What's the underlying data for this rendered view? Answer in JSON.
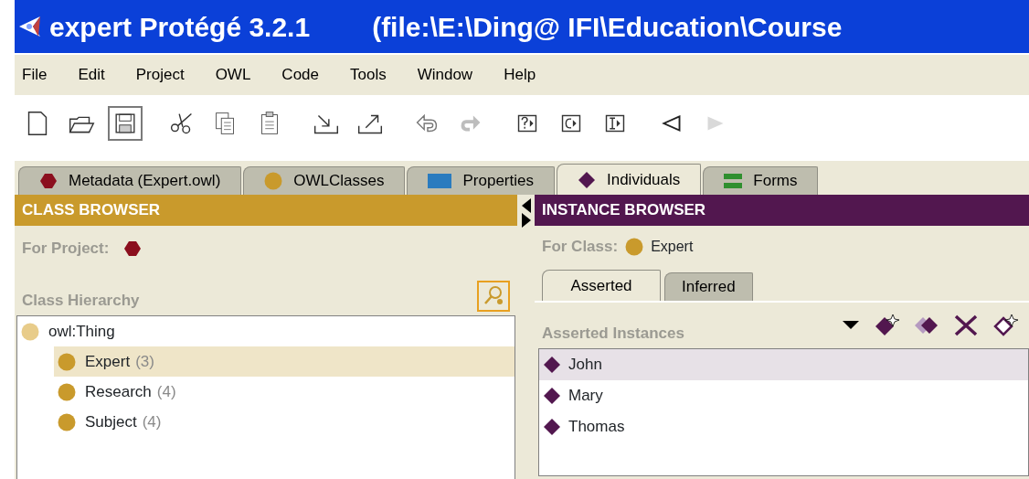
{
  "window": {
    "title": "expert  Protégé 3.2.1",
    "path": "(file:\\E:\\Ding@ IFI\\Education\\Course"
  },
  "menu": [
    {
      "label": "File"
    },
    {
      "label": "Edit"
    },
    {
      "label": "Project"
    },
    {
      "label": "OWL"
    },
    {
      "label": "Code"
    },
    {
      "label": "Tools"
    },
    {
      "label": "Window"
    },
    {
      "label": "Help"
    }
  ],
  "toolbar": [
    {
      "kind": "new",
      "pressed": false,
      "disabled": false
    },
    {
      "kind": "open",
      "pressed": false,
      "disabled": false
    },
    {
      "kind": "save",
      "pressed": true,
      "disabled": false
    },
    {
      "kind": "cut",
      "pressed": false,
      "disabled": false
    },
    {
      "kind": "copy",
      "pressed": false,
      "disabled": false
    },
    {
      "kind": "paste",
      "pressed": false,
      "disabled": false
    },
    {
      "kind": "import",
      "pressed": false,
      "disabled": false
    },
    {
      "kind": "export",
      "pressed": false,
      "disabled": false
    },
    {
      "kind": "undo",
      "pressed": false,
      "disabled": false
    },
    {
      "kind": "redo",
      "pressed": false,
      "disabled": true
    },
    {
      "kind": "query",
      "pressed": false,
      "disabled": false
    },
    {
      "kind": "class",
      "pressed": false,
      "disabled": false
    },
    {
      "kind": "instance",
      "pressed": false,
      "disabled": false
    },
    {
      "kind": "back",
      "pressed": false,
      "disabled": false
    },
    {
      "kind": "forward",
      "pressed": false,
      "disabled": true
    }
  ],
  "tabs": [
    {
      "label": "Metadata (Expert.owl)",
      "kind": "metadata",
      "selected": false
    },
    {
      "label": "OWLClasses",
      "kind": "classes",
      "selected": false
    },
    {
      "label": "Properties",
      "kind": "properties",
      "selected": false
    },
    {
      "label": "Individuals",
      "kind": "individuals",
      "selected": true
    },
    {
      "label": "Forms",
      "kind": "forms",
      "selected": false
    }
  ],
  "class_browser": {
    "title": "CLASS BROWSER",
    "for_project_label": "For Project:",
    "hierarchy_label": "Class Hierarchy",
    "tree": [
      {
        "label": "owl:Thing",
        "kind": "root",
        "selected": false,
        "children": [
          {
            "label": "Expert",
            "count": "(3)",
            "kind": "class",
            "selected": true
          },
          {
            "label": "Research",
            "count": "(4)",
            "kind": "class",
            "selected": false
          },
          {
            "label": "Subject",
            "count": "(4)",
            "kind": "class",
            "selected": false
          }
        ]
      }
    ]
  },
  "instance_browser": {
    "title": "INSTANCE BROWSER",
    "for_class_label": "For Class:",
    "for_class_value": "Expert",
    "tabs": [
      {
        "label": "Asserted",
        "selected": true
      },
      {
        "label": "Inferred",
        "selected": false
      }
    ],
    "list_label": "Asserted Instances",
    "instances": [
      {
        "label": "John",
        "selected": true
      },
      {
        "label": "Mary",
        "selected": false
      },
      {
        "label": "Thomas",
        "selected": false
      }
    ]
  }
}
